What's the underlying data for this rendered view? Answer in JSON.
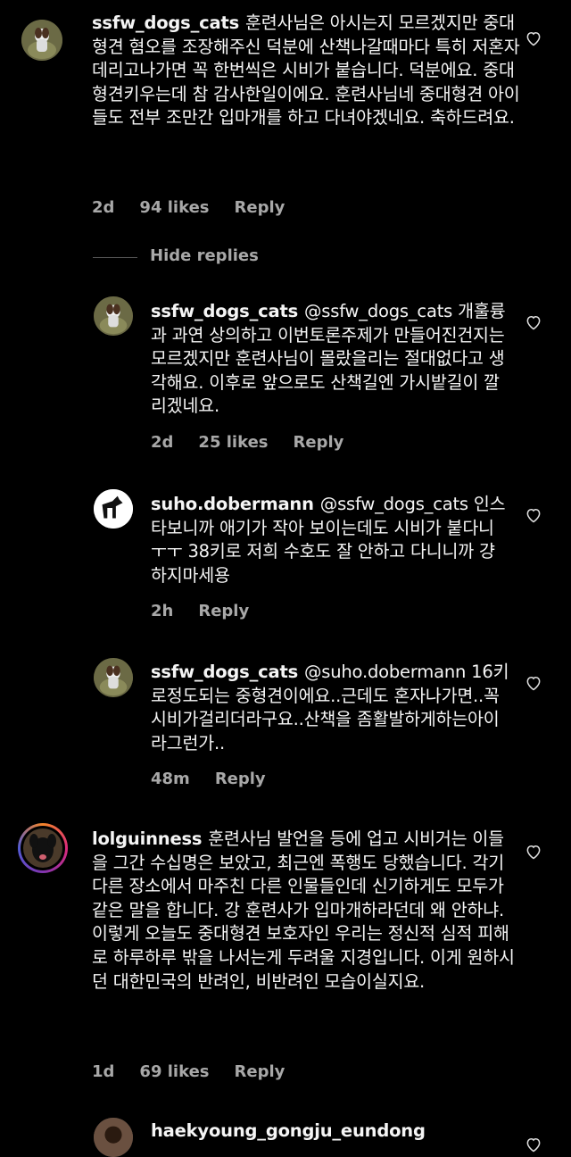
{
  "comments": [
    {
      "username": "ssfw_dogs_cats",
      "text": "훈련사님은 아시는지 모르겠지만 중대형견 혐오를 조장해주신 덕분에 산책나갈때마다 특히 저혼자 데리고나가면 꼭 한번씩은 시비가 붙습니다. 덕분에요. 중대형견키우는데 참 감사한일이에요. 훈련사님네 중대형견 아이들도 전부 조만간 입마개를 하고 다녀야겠네요. 축하드려요.",
      "time": "2d",
      "likes": "94 likes",
      "reply": "Reply"
    },
    {
      "username": "ssfw_dogs_cats",
      "text": "@ssfw_dogs_cats 개훌륭과 과연 상의하고 이번토론주제가 만들어진건지는 모르겠지만 훈련사님이 몰랐을리는 절대없다고 생각해요. 이후로 앞으로도 산책길엔 가시밭길이 깔리겠네요.",
      "time": "2d",
      "likes": "25 likes",
      "reply": "Reply"
    },
    {
      "username": "suho.dobermann",
      "text": "@ssfw_dogs_cats 인스타보니까 애기가 작아 보이는데도 시비가 붙다니 ㅜㅜ 38키로 저희 수호도 잘 안하고 다니니까 걍 하지마세용",
      "time": "2h",
      "reply": "Reply"
    },
    {
      "username": "ssfw_dogs_cats",
      "text": "@suho.dobermann 16키로정도되는 중형견이에요..근데도 혼자나가면..꼭 시비가걸리더라구요..산책을 좀활발하게하는아이라그런가..",
      "time": "48m",
      "reply": "Reply"
    },
    {
      "username": "lolguinness",
      "text": "훈련사님 발언을 등에 업고 시비거는 이들을 그간 수십명은 보았고, 최근엔 폭행도 당했습니다. 각기 다른 장소에서 마주친 다른 인물들인데 신기하게도 모두가 같은 말을 합니다. 강 훈련사가 입마개하라던데 왜 안하냐. 이렇게 오늘도 중대형견 보호자인 우리는 정신적 심적 피해로 하루하루 밖을 나서는게 두려울 지경입니다. 이게 원하시던 대한민국의 반려인, 비반려인 모습이실지요.",
      "time": "1d",
      "likes": "69 likes",
      "reply": "Reply"
    },
    {
      "username": "haekyoung_gongju_eundong"
    }
  ],
  "hide_replies": "Hide replies",
  "icons": {
    "like": "heart-icon"
  }
}
